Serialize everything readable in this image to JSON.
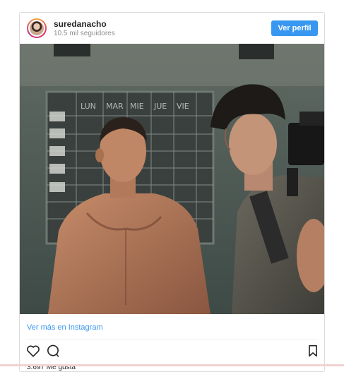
{
  "header": {
    "username": "suredanacho",
    "followers": "10.5 mil seguidores",
    "follow_button": "Ver perfil"
  },
  "post": {
    "image_description": "movie still",
    "more_link": "Ver más en Instagram",
    "likes": "3.697 Me gusta"
  },
  "board": {
    "days": [
      "LUN",
      "MAR",
      "MIE",
      "JUE",
      "VIE"
    ]
  },
  "icons": {
    "like": "heart-icon",
    "comment": "comment-icon",
    "save": "bookmark-icon"
  },
  "colors": {
    "accent": "#3897f0",
    "text": "#262626",
    "muted": "#8e8e8e",
    "border": "#dbdbdb"
  }
}
